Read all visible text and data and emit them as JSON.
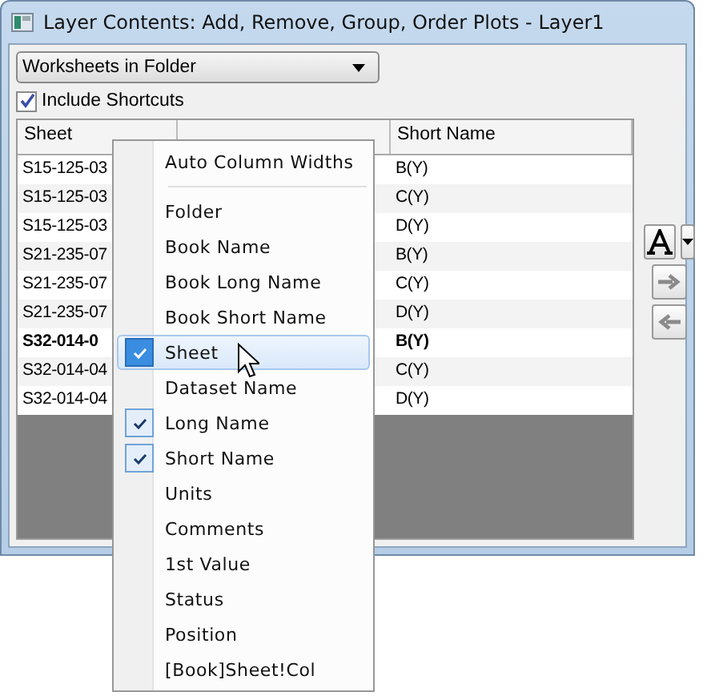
{
  "window": {
    "title": "Layer Contents: Add, Remove, Group, Order Plots - Layer1"
  },
  "source_dropdown": {
    "value": "Worksheets in Folder"
  },
  "include_shortcuts": {
    "label": "Include Shortcuts",
    "checked": true
  },
  "table": {
    "columns": [
      "Sheet",
      "Short Name"
    ],
    "rows": [
      {
        "sheet": "S15-125-03",
        "short_name": "B(Y)",
        "current": false
      },
      {
        "sheet": "S15-125-03",
        "short_name": "C(Y)",
        "current": false
      },
      {
        "sheet": "S15-125-03",
        "short_name": "D(Y)",
        "current": false
      },
      {
        "sheet": "S21-235-07",
        "short_name": "B(Y)",
        "current": false
      },
      {
        "sheet": "S21-235-07",
        "short_name": "C(Y)",
        "current": false
      },
      {
        "sheet": "S21-235-07",
        "short_name": "D(Y)",
        "current": false
      },
      {
        "sheet": "S32-014-0",
        "short_name": "B(Y)",
        "current": true
      },
      {
        "sheet": "S32-014-04",
        "short_name": "C(Y)",
        "current": false
      },
      {
        "sheet": "S32-014-04",
        "short_name": "D(Y)",
        "current": false
      }
    ]
  },
  "side_buttons": [
    {
      "kind": "font"
    },
    {
      "kind": "dropdown"
    },
    {
      "kind": "add"
    },
    {
      "kind": "remove"
    }
  ],
  "context_menu": {
    "items": [
      {
        "kind": "command",
        "label": "Auto Column Widths"
      },
      {
        "kind": "separator"
      },
      {
        "kind": "option",
        "label": "Folder",
        "checked": false,
        "highlighted": false
      },
      {
        "kind": "option",
        "label": "Book Name",
        "checked": false,
        "highlighted": false
      },
      {
        "kind": "option",
        "label": "Book Long Name",
        "checked": false,
        "highlighted": false
      },
      {
        "kind": "option",
        "label": "Book Short Name",
        "checked": false,
        "highlighted": false
      },
      {
        "kind": "option",
        "label": "Sheet",
        "checked": true,
        "highlighted": true
      },
      {
        "kind": "option",
        "label": "Dataset Name",
        "checked": false,
        "highlighted": false
      },
      {
        "kind": "option",
        "label": "Long Name",
        "checked": true,
        "highlighted": false
      },
      {
        "kind": "option",
        "label": "Short Name",
        "checked": true,
        "highlighted": false
      },
      {
        "kind": "option",
        "label": "Units",
        "checked": false,
        "highlighted": false
      },
      {
        "kind": "option",
        "label": "Comments",
        "checked": false,
        "highlighted": false
      },
      {
        "kind": "option",
        "label": "1st Value",
        "checked": false,
        "highlighted": false
      },
      {
        "kind": "option",
        "label": "Status",
        "checked": false,
        "highlighted": false
      },
      {
        "kind": "option",
        "label": "Position",
        "checked": false,
        "highlighted": false
      },
      {
        "kind": "option",
        "label": "[Book]Sheet!Col",
        "checked": false,
        "highlighted": false
      }
    ]
  }
}
